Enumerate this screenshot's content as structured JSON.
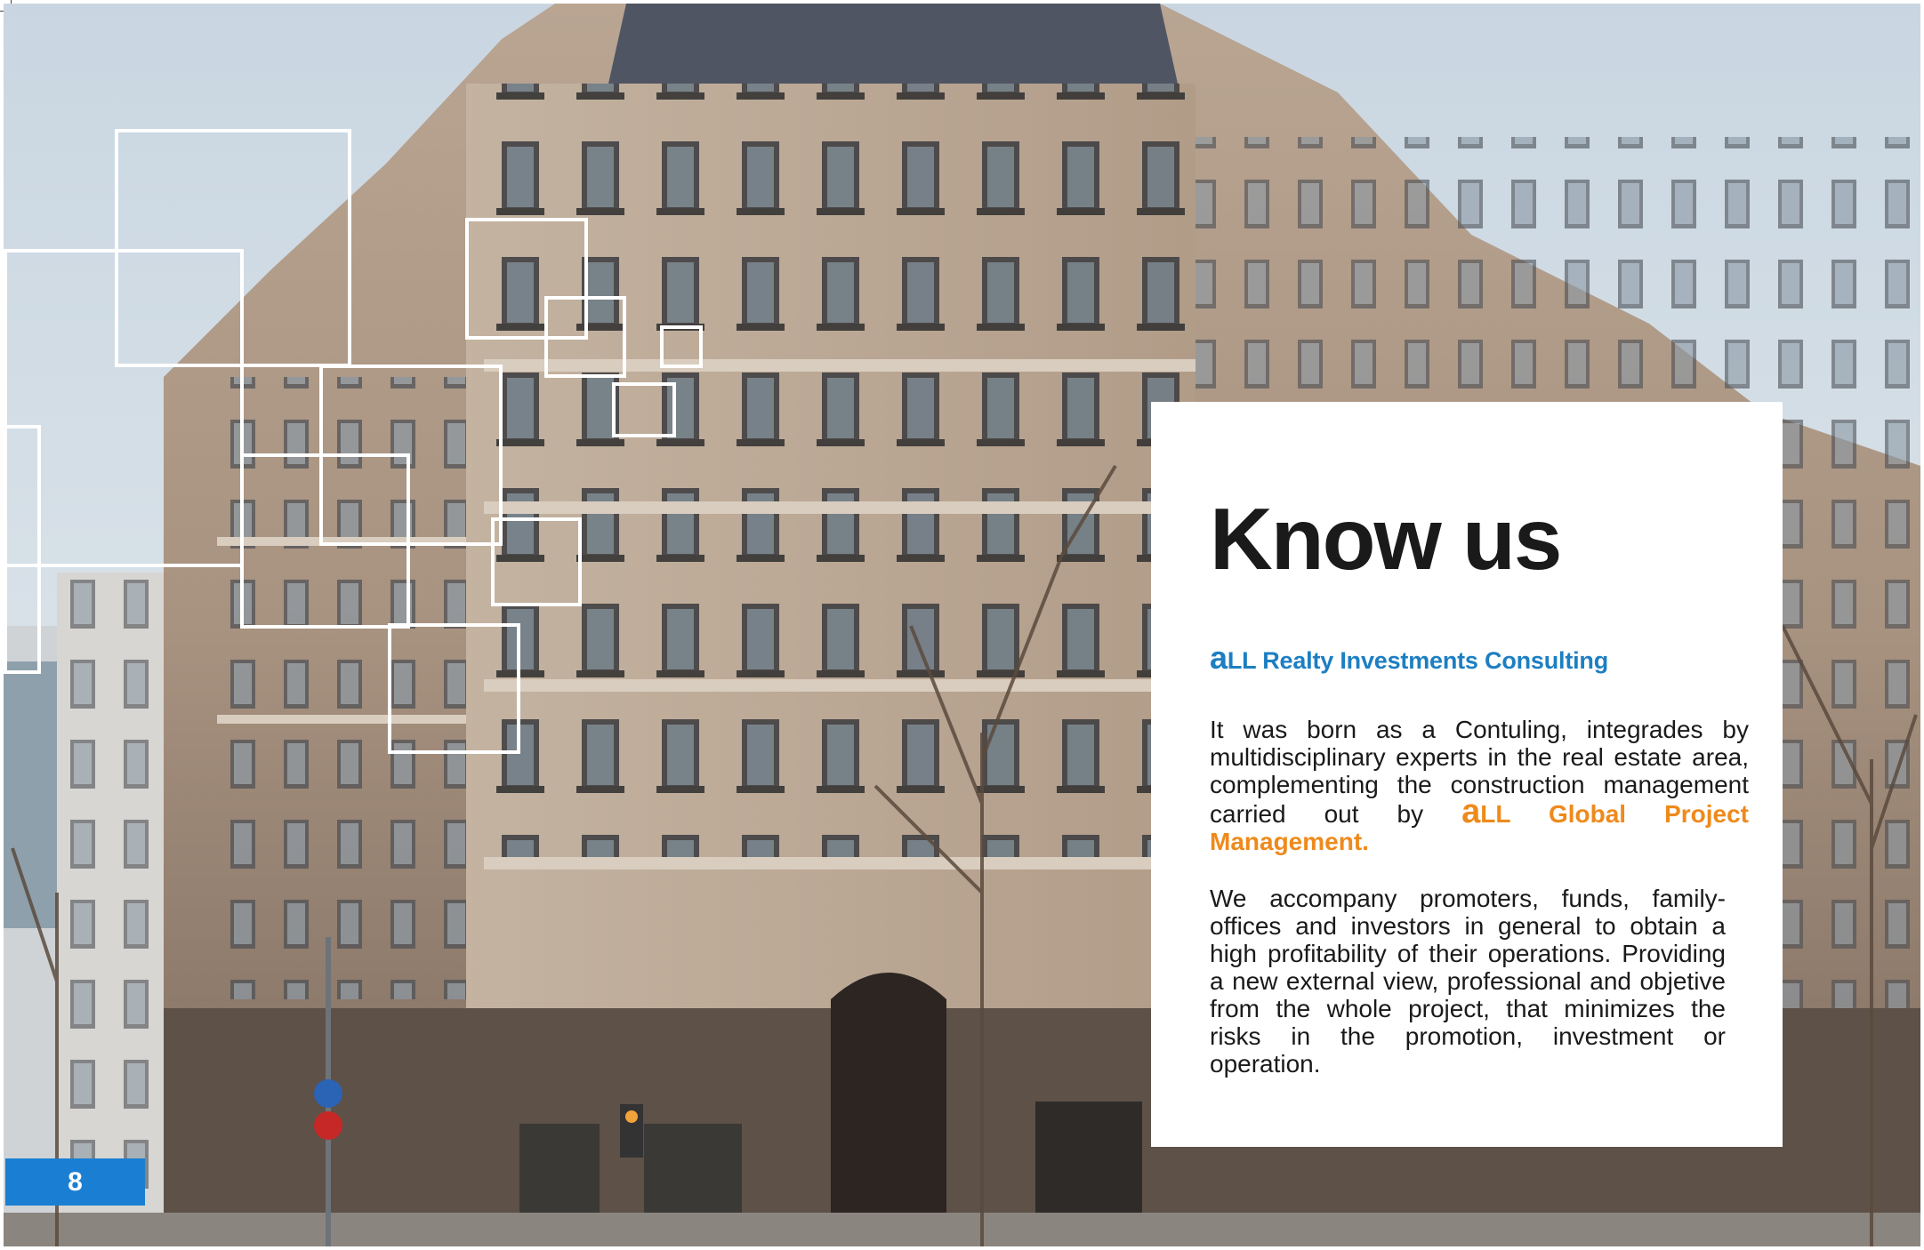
{
  "page_number": "8",
  "card": {
    "title": "Know us",
    "subtitle_a": "a",
    "subtitle_rest": "LL Realty Investments Consulting",
    "para1_text": "It was born as a Contuling, integrades by multidisciplinary experts in the real estate area, complementing the construction management carried out by ",
    "para1_brand_a": "a",
    "para1_brand_rest": "LL Global Project Management.",
    "para2_text": "We accompany promoters, funds, family-offices and investors in general to obtain a high profitability of their operations. Providing a new external view, professional and objetive from the whole project, that minimizes the risks in the promotion, investment or operation."
  },
  "colors": {
    "accent_blue": "#1d7fc2",
    "accent_orange": "#ee8a1c",
    "page_tab": "#1a7fd3"
  }
}
